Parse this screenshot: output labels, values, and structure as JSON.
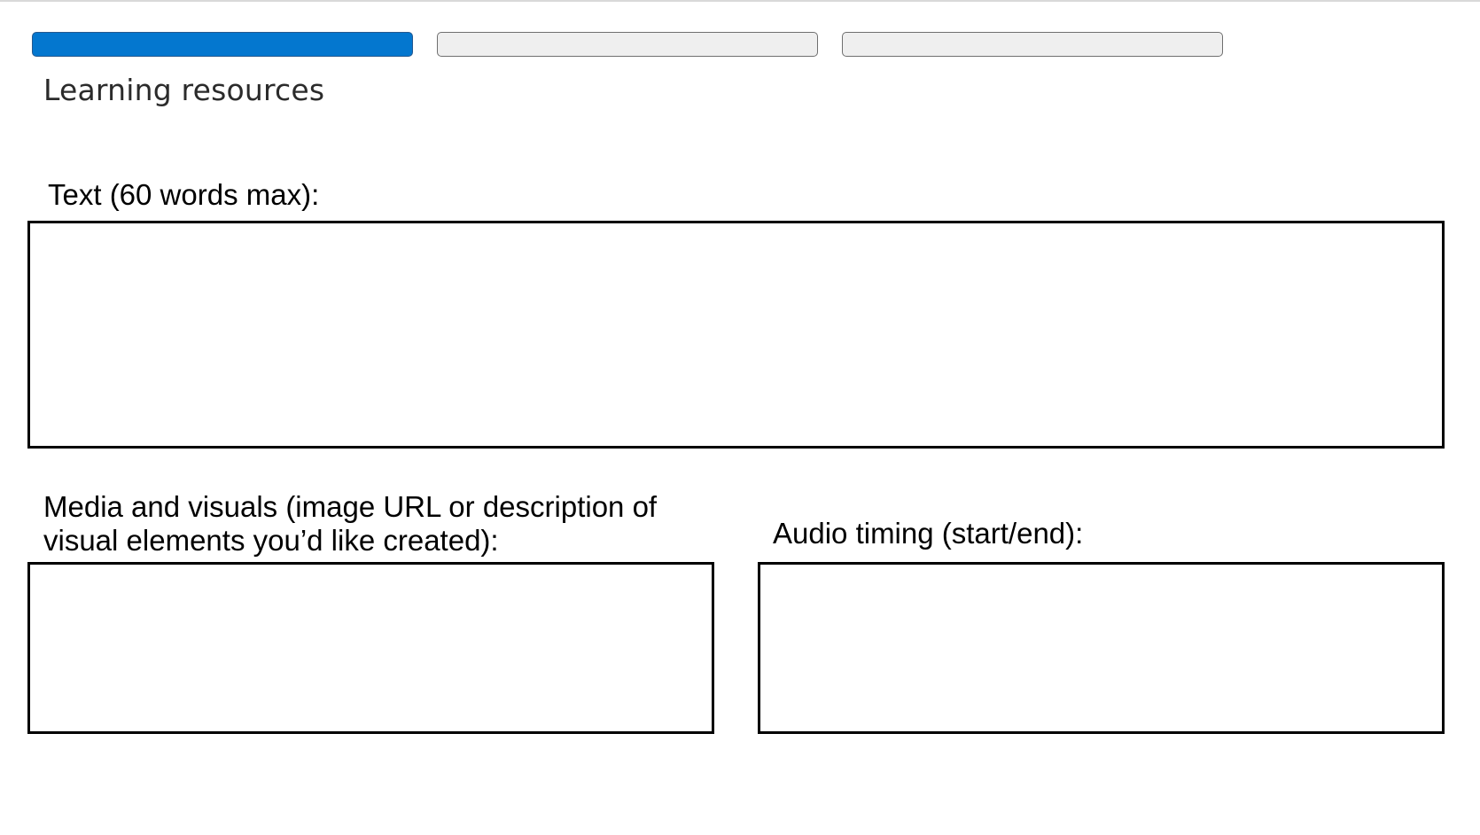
{
  "progress": {
    "steps": [
      {
        "state": "active"
      },
      {
        "state": "inactive"
      },
      {
        "state": "inactive"
      }
    ],
    "current_step": 1,
    "total_steps": 3,
    "colors": {
      "active": "#0477cf",
      "inactive": "#efefef"
    }
  },
  "page": {
    "title": "Learning resources"
  },
  "fields": {
    "text": {
      "label": "Text (60 words max):",
      "value": ""
    },
    "media": {
      "label": "Media and visuals (image URL or description of visual elements you’d like created):",
      "value": ""
    },
    "audio": {
      "label": "Audio timing (start/end):",
      "value": ""
    }
  }
}
